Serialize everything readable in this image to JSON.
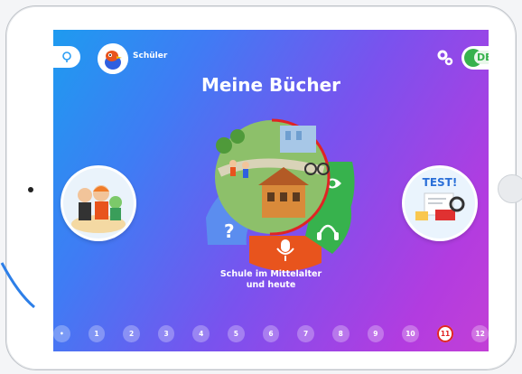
{
  "header": {
    "user_label": "Schüler",
    "lang_label": "DE"
  },
  "main": {
    "title": "Meine Bücher",
    "book_title_line1": "Schule im Mittelalter",
    "book_title_line2": "und heute",
    "test_label": "TEST!"
  },
  "pager": {
    "pages": [
      "•",
      "1",
      "2",
      "3",
      "4",
      "5",
      "6",
      "7",
      "8",
      "9",
      "10",
      "11",
      "12"
    ],
    "active_index": 11
  },
  "colors": {
    "accent_green": "#37b24d",
    "accent_red": "#e02424",
    "accent_orange": "#e8541d",
    "accent_blue": "#5b8def",
    "gradient_start": "#1e9bf0",
    "gradient_end": "#c23fd6"
  },
  "icons": {
    "back": "pin-icon",
    "settings": "gear-icon",
    "help": "question-icon",
    "record": "microphone-icon",
    "listen": "headphones-icon",
    "read": "eye-icon"
  }
}
